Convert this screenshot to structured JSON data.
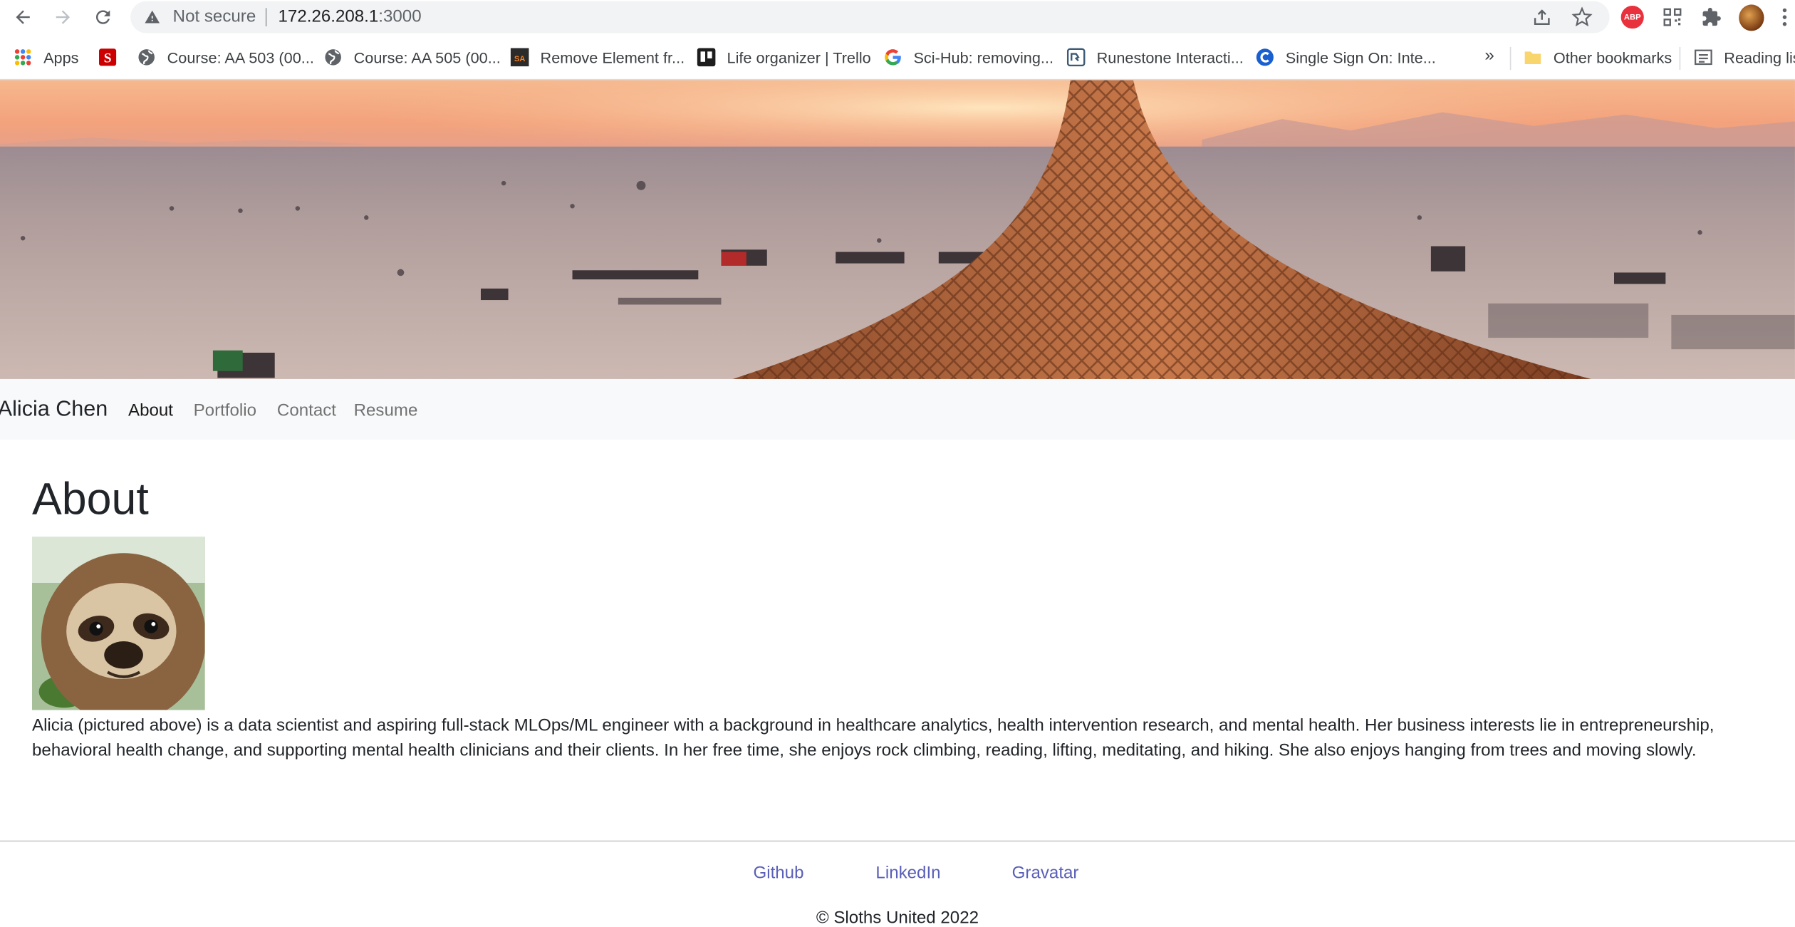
{
  "browser": {
    "security_label": "Not secure",
    "url_host": "172.26.208.1",
    "url_port": ":3000",
    "extensions": {
      "adblock_label": "ABP"
    }
  },
  "bookmarks": {
    "items": [
      {
        "label": "Apps",
        "icon": "apps-grid-icon"
      },
      {
        "label": "",
        "icon": "ncstate-icon"
      },
      {
        "label": "Course: AA 503 (00...",
        "icon": "globe-icon"
      },
      {
        "label": "Course: AA 505 (00...",
        "icon": "globe-icon"
      },
      {
        "label": "Remove Element fr...",
        "icon": "sa-icon"
      },
      {
        "label": "Life organizer | Trello",
        "icon": "trello-icon"
      },
      {
        "label": "Sci-Hub: removing...",
        "icon": "google-icon"
      },
      {
        "label": "Runestone Interacti...",
        "icon": "runestone-icon"
      },
      {
        "label": "Single Sign On: Inte...",
        "icon": "sso-icon"
      }
    ],
    "overflow_label": "»",
    "other_label": "Other bookmarks",
    "reading_label": "Reading list"
  },
  "site": {
    "brand": "Alicia Chen",
    "nav": [
      {
        "label": "About",
        "active": true
      },
      {
        "label": "Portfolio",
        "active": false
      },
      {
        "label": "Contact",
        "active": false
      },
      {
        "label": "Resume",
        "active": false
      }
    ]
  },
  "about": {
    "title": "About",
    "bio": "Alicia (pictured above) is a data scientist and aspiring full-stack MLOps/ML engineer with a background in healthcare analytics, health intervention research, and mental health. Her business interests lie in entrepreneurship, behavioral health change, and supporting mental health clinicians and their clients. In her free time, she enjoys rock climbing, reading, lifting, meditating, and hiking. She also enjoys hanging from trees and moving slowly."
  },
  "footer": {
    "links": [
      "Github",
      "LinkedIn",
      "Gravatar"
    ],
    "copyright": "© Sloths United 2022"
  },
  "colors": {
    "nav_bg": "#f8f9fa",
    "footer_link": "#5a5fb8",
    "omnibox_bg": "#f1f3f4"
  }
}
